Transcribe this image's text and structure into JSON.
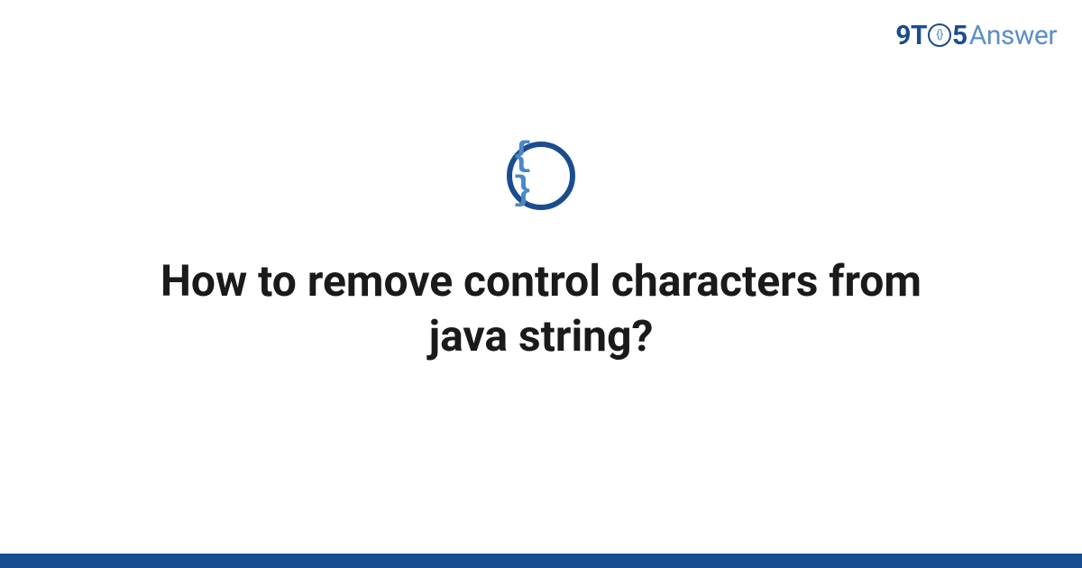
{
  "logo": {
    "part1": "9T",
    "circle_inner": "{}",
    "part2": "5",
    "part3": "Answer"
  },
  "icon": {
    "braces": "{ }"
  },
  "title": "How to remove control characters from java string?",
  "colors": {
    "primary": "#1a4d8f",
    "secondary": "#5b8fc7",
    "brace_fill": "#4a89c8"
  }
}
